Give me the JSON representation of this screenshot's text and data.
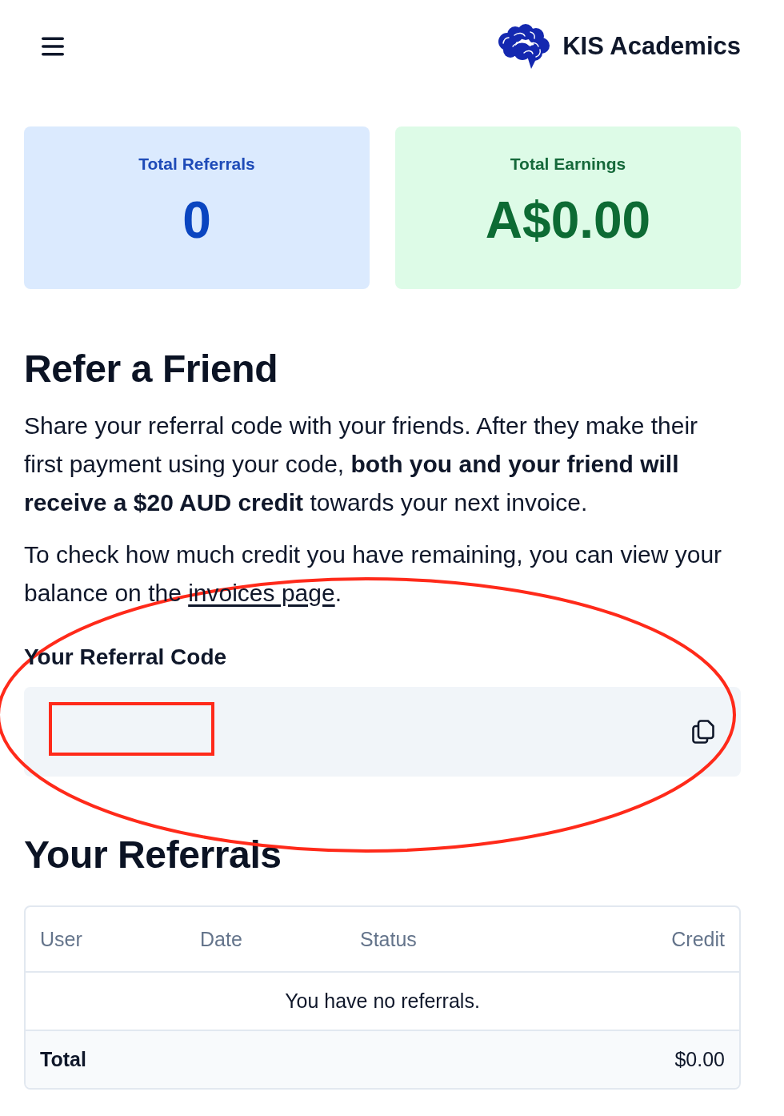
{
  "header": {
    "brand": "KIS Academics"
  },
  "stats": [
    {
      "kind": "referrals",
      "label": "Total Referrals",
      "value": "0"
    },
    {
      "kind": "earnings",
      "label": "Total Earnings",
      "value": "A$0.00"
    }
  ],
  "refer": {
    "title": "Refer a Friend",
    "intro": "Share your referral code with your friends. After they make their first payment using your code, **both you and your friend will receive a $20 AUD credit** towards your next invoice.",
    "balance_note": {
      "text_before": "To check how much credit you have remaining, you can view your balance on the ",
      "link": "invoices page",
      "text_after": "."
    }
  },
  "referral_code": {
    "label": "Your Referral Code"
  },
  "annotations": [
    {
      "kind": "ellipse"
    },
    {
      "kind": "rectangle"
    }
  ],
  "referrals": {
    "title": "Your Referrals",
    "columns": [
      "User",
      "Date",
      "Status",
      "Credit"
    ],
    "empty_message": "You have no referrals.",
    "footer": {
      "label": "Total",
      "value": "$0.00"
    }
  }
}
